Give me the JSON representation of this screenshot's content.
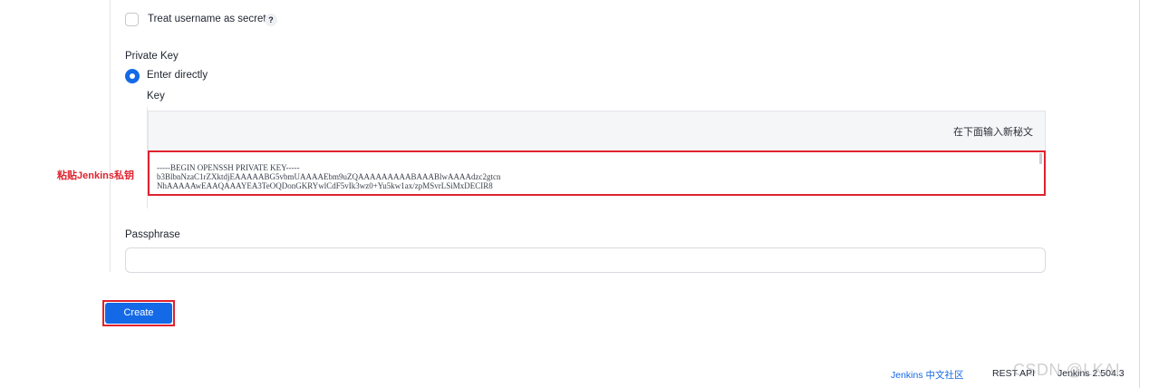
{
  "form": {
    "treat_username_secret": {
      "label": "Treat username as secret",
      "checked": false,
      "help": "?"
    },
    "private_key": {
      "section_label": "Private Key",
      "option_label": "Enter directly",
      "key_label": "Key",
      "hint": "在下面输入新秘文",
      "value_lines": [
        "-----BEGIN OPENSSH PRIVATE KEY-----",
        "b3BlbnNzaC1rZXktdjEAAAAABG5vbmUAAAAEbm9uZQAAAAAAAAABAAABlwAAAAdzc2gtcn",
        "NhAAAAAwEAAQAAAYEA3TeOQDonGKRYwlCdF5vIk3wz0+Yu5kw1ax/zpMSvrLSiMxDECIR8"
      ]
    },
    "passphrase": {
      "label": "Passphrase",
      "value": ""
    },
    "create_label": "Create"
  },
  "annotation": {
    "text": "粘贴Jenkins私钥",
    "color": "#e0222f"
  },
  "footer": {
    "community_link": "Jenkins 中文社区",
    "rest_api": "REST API",
    "version": "Jenkins 2.504.3"
  },
  "watermark": "CSDN @LKAI",
  "colors": {
    "accent": "#1469e6",
    "highlight": "#e0222f"
  }
}
